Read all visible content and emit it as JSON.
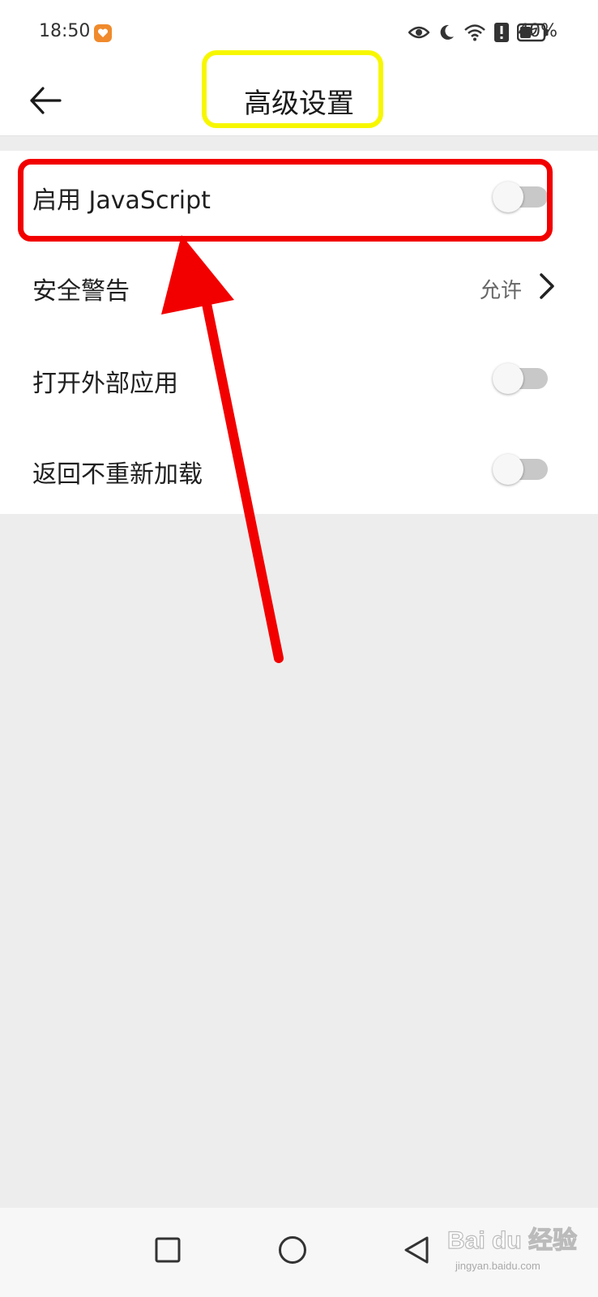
{
  "status_bar": {
    "time": "18:50",
    "battery": "40%",
    "icons": [
      "app-badge-icon",
      "eye-icon",
      "moon-icon",
      "wifi-icon",
      "alert-icon",
      "battery-icon"
    ]
  },
  "header": {
    "title": "高级设置",
    "back_icon": "arrow-left-icon"
  },
  "settings": {
    "items": [
      {
        "label": "启用 JavaScript",
        "type": "toggle",
        "on": false
      },
      {
        "label": "安全警告",
        "type": "link",
        "value": "允许"
      },
      {
        "label": "打开外部应用",
        "type": "toggle",
        "on": false
      },
      {
        "label": "返回不重新加载",
        "type": "toggle",
        "on": false
      }
    ]
  },
  "nav": {
    "icons": [
      "square-icon",
      "circle-icon",
      "triangle-back-icon"
    ]
  },
  "watermark": {
    "text": "Bai du 经验",
    "url": "jingyan.baidu.com"
  },
  "colors": {
    "highlight_red": "#f20000",
    "highlight_yellow": "#f7f700",
    "toggle_track": "#c8c8c8",
    "background": "#ededed"
  }
}
